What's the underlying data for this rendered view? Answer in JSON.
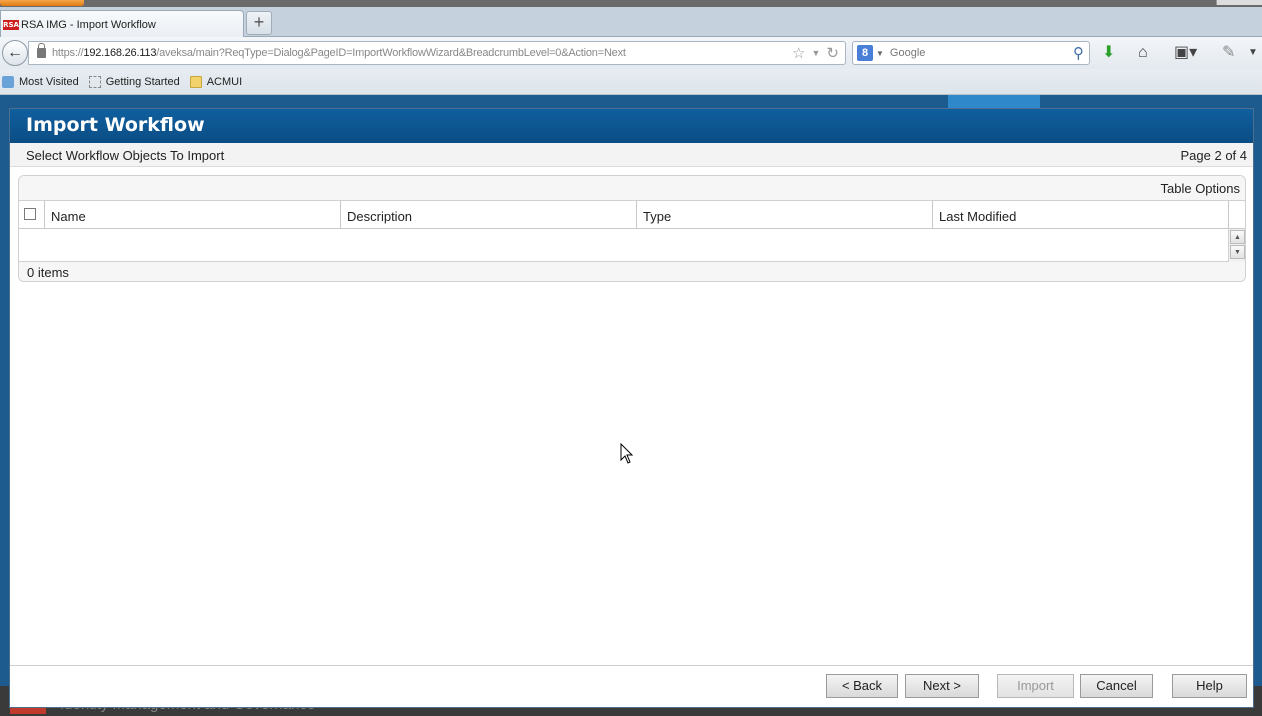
{
  "browser": {
    "tab_title": "RSA IMG - Import Workflow",
    "tab_favicon_text": "RSA",
    "url_prefix": "https://",
    "url_host": "192.168.26.113",
    "url_path": "/aveksa/main?ReqType=Dialog&PageID=ImportWorkflowWizard&BreadcrumbLevel=0&Action=Next",
    "search_placeholder": "Google",
    "search_engine_letter": "8",
    "bookmarks": [
      "Most Visited",
      "Getting Started",
      "ACMUI"
    ]
  },
  "dialog": {
    "title": "Import Workflow",
    "step_title": "Select Workflow Objects To Import",
    "page_indicator": "Page 2 of 4",
    "table": {
      "options_label": "Table Options",
      "columns": [
        "Name",
        "Description",
        "Type",
        "Last Modified"
      ],
      "rows": [],
      "item_count": "0 items"
    },
    "buttons": {
      "back": "< Back",
      "next": "Next >",
      "import": "Import",
      "cancel": "Cancel",
      "help": "Help"
    }
  },
  "app_footer": {
    "title": "Identity Management and Governance"
  },
  "colors": {
    "header_blue": "#0f5f9e",
    "app_background": "#1d5a8e"
  }
}
